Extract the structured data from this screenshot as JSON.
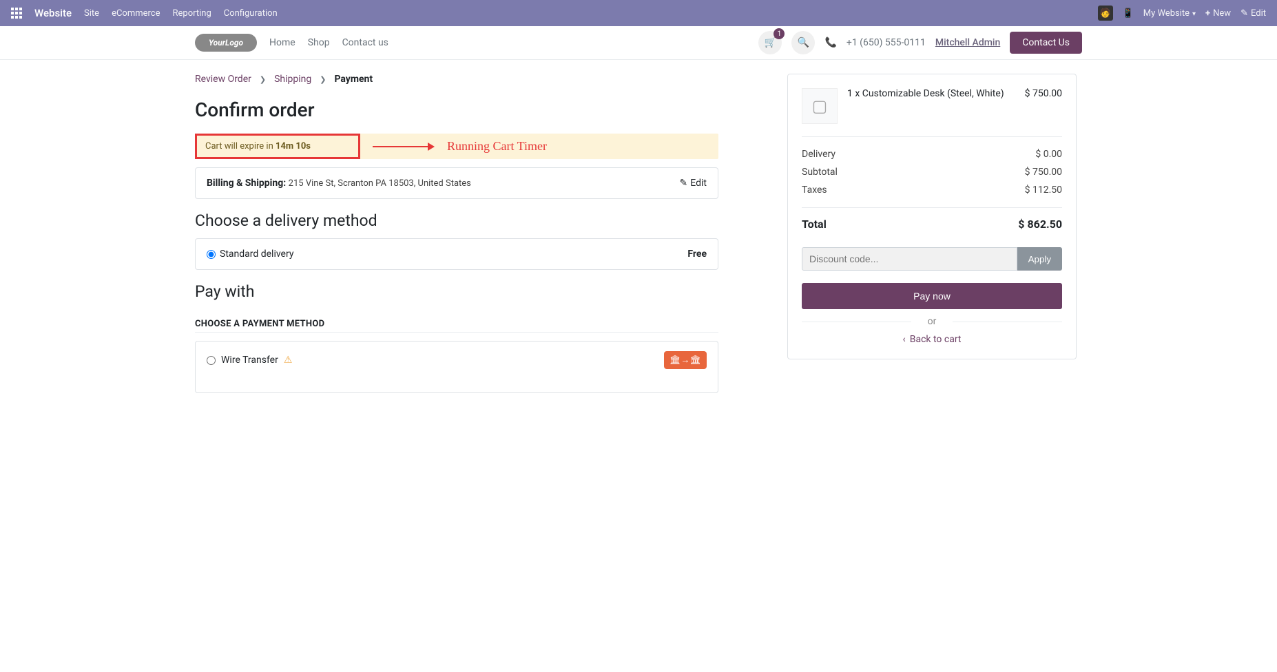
{
  "admin": {
    "brand": "Website",
    "menu": [
      "Site",
      "eCommerce",
      "Reporting",
      "Configuration"
    ],
    "website_switch": "My Website",
    "new": "New",
    "edit": "Edit"
  },
  "header": {
    "logo_text": "YourLogo",
    "nav": [
      "Home",
      "Shop",
      "Contact us"
    ],
    "cart_count": "1",
    "phone": "+1 (650) 555-0111",
    "user": "Mitchell Admin",
    "contact_btn": "Contact Us"
  },
  "breadcrumb": {
    "items": [
      "Review Order",
      "Shipping"
    ],
    "current": "Payment"
  },
  "page": {
    "title": "Confirm order",
    "timer_prefix": "Cart will expire in ",
    "timer_value": "14m 10s",
    "annotation": "Running Cart Timer",
    "shipping_label": "Billing & Shipping:",
    "shipping_addr": "215 Vine St, Scranton PA 18503, United States",
    "edit": "Edit",
    "delivery_heading": "Choose a delivery method",
    "delivery_option": "Standard delivery",
    "delivery_price": "Free",
    "pay_heading": "Pay with",
    "pay_section": "Choose a payment method",
    "pay_option": "Wire Transfer"
  },
  "summary": {
    "qty_name": "1 x Customizable Desk (Steel, White)",
    "item_price": "$ 750.00",
    "lines": [
      {
        "label": "Delivery",
        "value": "$ 0.00"
      },
      {
        "label": "Subtotal",
        "value": "$ 750.00"
      },
      {
        "label": "Taxes",
        "value": "$ 112.50"
      }
    ],
    "total_label": "Total",
    "total_value": "$ 862.50",
    "discount_placeholder": "Discount code...",
    "apply": "Apply",
    "pay_now": "Pay now",
    "or": "or",
    "back": "Back to cart"
  }
}
